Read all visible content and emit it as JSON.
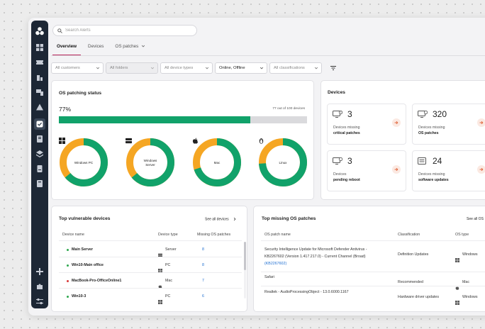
{
  "search": {
    "placeholder": "Search Alerts"
  },
  "tabs": [
    {
      "label": "Overview",
      "active": true
    },
    {
      "label": "Devices",
      "active": false
    },
    {
      "label": "OS patches",
      "active": false
    }
  ],
  "filters": [
    {
      "value": "All customers",
      "selected": false,
      "disabled": false
    },
    {
      "value": "All folders",
      "selected": false,
      "disabled": true
    },
    {
      "value": "All device types",
      "selected": false,
      "disabled": false
    },
    {
      "value": "Online, Offline",
      "selected": true,
      "disabled": false
    },
    {
      "value": "All classifications",
      "selected": false,
      "disabled": false
    }
  ],
  "os_status": {
    "title": "OS patching status",
    "percent": "77%",
    "percent_value": 0.77,
    "count_label": "77 out of 100 devices",
    "donuts": [
      {
        "label": "Windows PC",
        "icon": "windows-icon",
        "fraction": 0.64
      },
      {
        "label": "Windows Server",
        "icon": "server-icon",
        "fraction": 0.64
      },
      {
        "label": "Mac",
        "icon": "apple-icon",
        "fraction": 0.7
      },
      {
        "label": "Linux",
        "icon": "linux-icon",
        "fraction": 0.74
      }
    ],
    "colors": {
      "done": "#11a26a",
      "pending": "#f5a623"
    }
  },
  "devices": {
    "title": "Devices",
    "tiles": [
      {
        "number": "3",
        "line1": "Devices missing",
        "line2": "critical patches"
      },
      {
        "number": "320",
        "line1": "Devices missing",
        "line2": "OS patches"
      },
      {
        "number": "3",
        "line1": "Devices",
        "line2": "pending reboot"
      },
      {
        "number": "24",
        "line1": "Devices missing",
        "line2": "software updates"
      }
    ]
  },
  "vulnerable": {
    "title": "Top vulnerable devices",
    "see_all": "See all devices",
    "headers": [
      "Device name",
      "Device type",
      "Missing OS patches"
    ],
    "rows": [
      {
        "name": "Main Server",
        "type": "Server",
        "missing": "8",
        "status": "#2fa84f",
        "icon": "server-icon"
      },
      {
        "name": "Win10-Main office",
        "type": "PC",
        "missing": "8",
        "status": "#2fa84f",
        "icon": "windows-icon"
      },
      {
        "name": "MacBook-Pro-OfficeOnline1",
        "type": "Mac",
        "missing": "7",
        "status": "#d93a3a",
        "icon": "apple-icon"
      },
      {
        "name": "Win10-3",
        "type": "PC",
        "missing": "6",
        "status": "#2fa84f",
        "icon": "windows-icon"
      }
    ]
  },
  "patches": {
    "title": "Top missing OS patches",
    "see_all": "See all OS",
    "headers": [
      "OS patch name",
      "Classification",
      "OS type"
    ],
    "rows": [
      {
        "name_lines": [
          "Security Intelligence Update for Microsoft Defender Antivirus -",
          "KB2267602 (Version 1.417.217.0) - Current Channel (Broad)"
        ],
        "link": "(KB2267602)",
        "classification": "Definition Updates",
        "os": "Windows",
        "icon": "windows-icon"
      },
      {
        "name_lines": [
          "Safari"
        ],
        "link": "",
        "classification": "Recommended",
        "os": "Mac",
        "icon": "apple-icon"
      },
      {
        "name_lines": [
          "Realtek - AudioProcessingObject - 13.0.6000.1167"
        ],
        "link": "",
        "classification": "Hardware driver updates",
        "os": "Windows",
        "icon": "windows-icon"
      }
    ]
  }
}
